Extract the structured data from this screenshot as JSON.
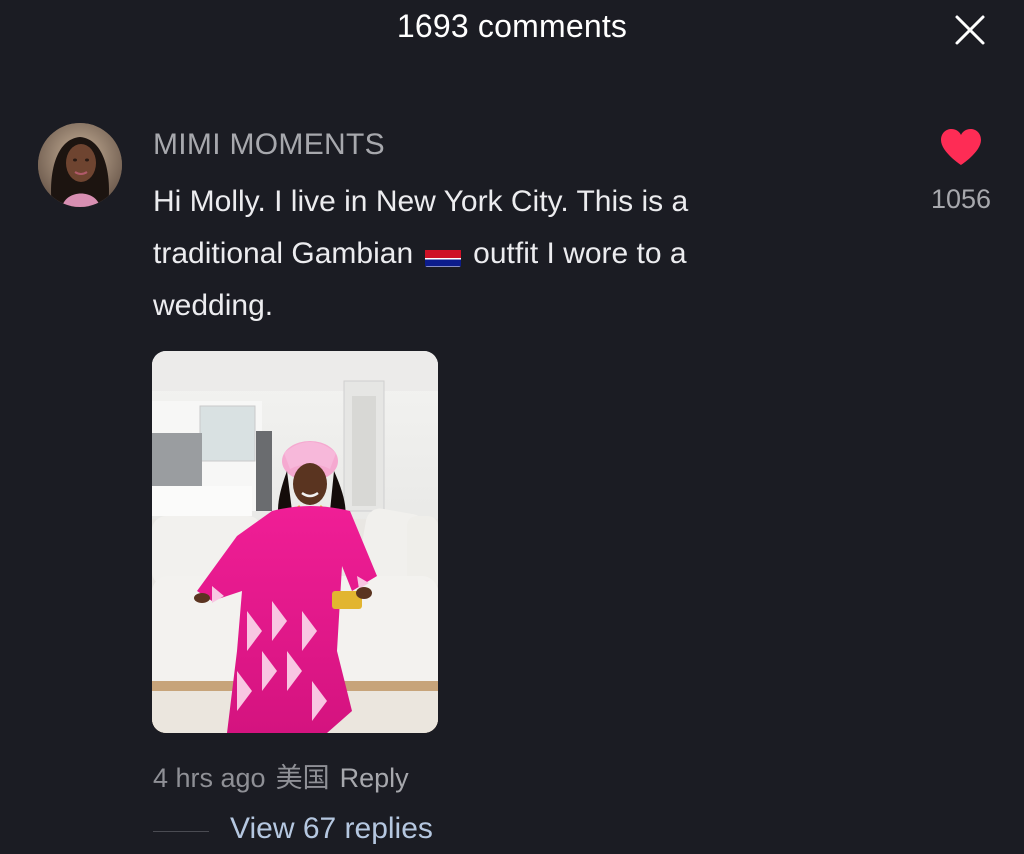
{
  "header": {
    "title": "1693 comments",
    "close_icon": "close-icon"
  },
  "comment": {
    "username": "MIMI MOMENTS",
    "text_before_flag": "Hi Molly. I live in New York City. This is a traditional Gambian",
    "flag_icon": "gambia-flag-emoji",
    "text_after_flag": "outfit I wore to a wedding.",
    "like_count": "1056",
    "heart_icon": "heart-icon",
    "heart_color": "#fe2c55",
    "time": "4 hrs ago",
    "location": "美国",
    "reply_label": "Reply",
    "view_replies_label": "View 67 replies"
  },
  "colors": {
    "background": "#1b1c23",
    "username": "#a7a8ad",
    "link": "#b5c7e0"
  }
}
